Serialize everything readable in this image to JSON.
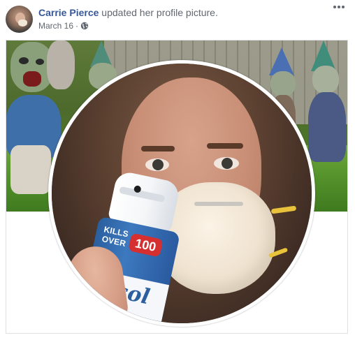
{
  "post": {
    "author": "Carrie Pierce",
    "action": " updated her profile picture.",
    "date": "March 16",
    "separator": "·",
    "privacy_icon": "globe-icon",
    "more_icon": "more-options-icon"
  },
  "spray_can": {
    "text_kills": "KILLS",
    "text_over": "OVER",
    "text_100": "100",
    "text_brand": "Lysol"
  },
  "colors": {
    "author_link": "#365899",
    "meta_text": "#606770",
    "border": "#dddfe2"
  }
}
